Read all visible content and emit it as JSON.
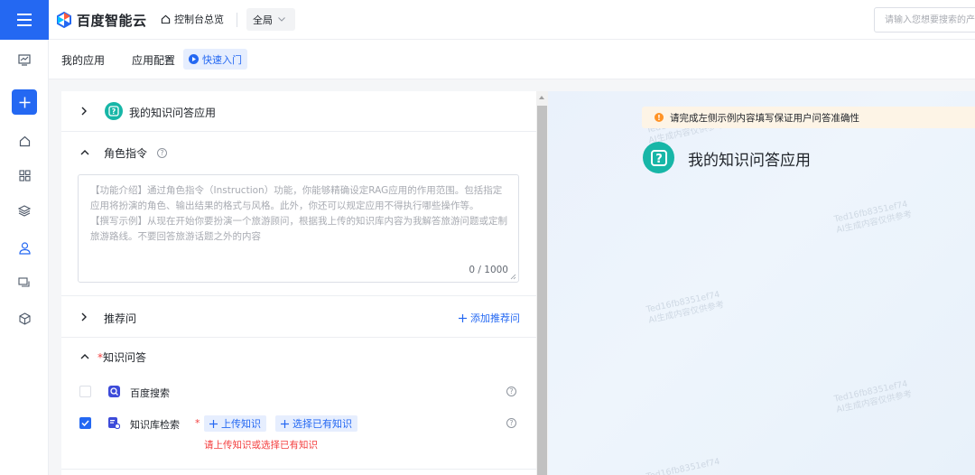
{
  "header": {
    "menu_icon": "hamburger-icon",
    "logo_text": "百度智能云",
    "console_label": "控制台总览",
    "region_label": "全局",
    "search_placeholder": "请输入您想要搜索的产品",
    "brand_color": "#2468f2"
  },
  "sidebar": {
    "items": [
      {
        "name": "chart-icon"
      },
      {
        "name": "add-icon"
      },
      {
        "name": "home-icon"
      },
      {
        "name": "grid-icon"
      },
      {
        "name": "layers-icon"
      },
      {
        "name": "user-icon"
      },
      {
        "name": "chat-icon"
      },
      {
        "name": "cube-icon"
      }
    ]
  },
  "breadcrumb": {
    "items": [
      "我的应用",
      "应用配置"
    ],
    "separator": ">",
    "quickstart_label": "快速入门"
  },
  "form": {
    "app_section": {
      "title": "我的知识问答应用",
      "expanded": false
    },
    "role_section": {
      "title": "角色指令",
      "expanded": true,
      "placeholder": "【功能介绍】通过角色指令（Instruction）功能，你能够精确设定RAG应用的作用范围。包括指定应用将扮演的角色、输出结果的格式与风格。此外，你还可以规定应用不得执行哪些操作等。\n【撰写示例】从现在开始你要扮演一个旅游顾问，根据我上传的知识库内容为我解答旅游问题或定制旅游路线。不要回答旅游话题之外的内容",
      "counter": "0 / 1000"
    },
    "recommend_section": {
      "title": "推荐问",
      "expanded": false,
      "add_label": "添加推荐问"
    },
    "knowledge_section": {
      "title": "知识问答",
      "required_mark": "*",
      "expanded": true,
      "tools": [
        {
          "label": "百度搜索",
          "checked": false,
          "icon": "baidu-search-icon"
        },
        {
          "label": "知识库检索",
          "checked": true,
          "icon": "kb-search-icon"
        }
      ],
      "upload_label": "上传知识",
      "select_label": "选择已有知识",
      "error_text": "请上传知识或选择已有知识"
    }
  },
  "preview": {
    "notice": "请完成左侧示例内容填写保证用户问答准确性",
    "notice_icon": "!",
    "app_title": "我的知识问答应用",
    "app_badge_color": "#17b6a7",
    "watermark_lines": [
      "Ted16fb8351ef74",
      "AI生成内容仅供参考"
    ]
  }
}
